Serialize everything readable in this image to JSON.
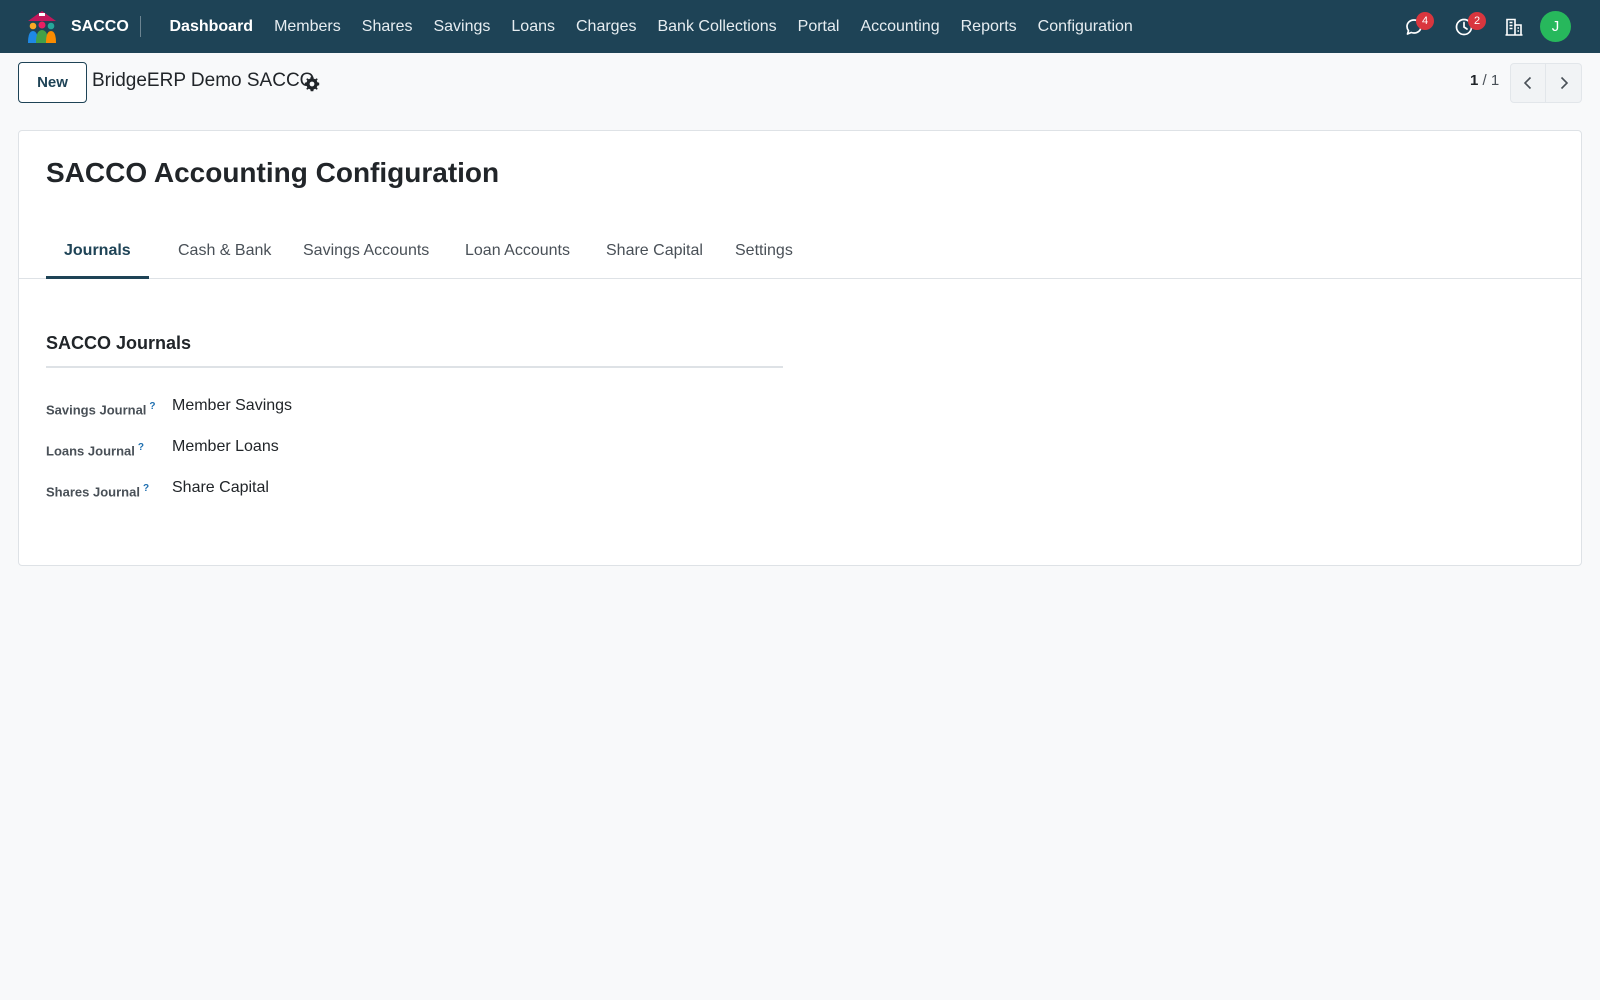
{
  "app": {
    "name": "SACCO",
    "menu": [
      {
        "label": "Dashboard",
        "active": true
      },
      {
        "label": "Members"
      },
      {
        "label": "Shares"
      },
      {
        "label": "Savings"
      },
      {
        "label": "Loans"
      },
      {
        "label": "Charges"
      },
      {
        "label": "Bank Collections"
      },
      {
        "label": "Portal"
      },
      {
        "label": "Accounting"
      },
      {
        "label": "Reports"
      },
      {
        "label": "Configuration"
      }
    ],
    "systray": {
      "messages_count": "4",
      "activities_count": "2",
      "user_initial": "J",
      "icons": [
        "chat-icon",
        "clock-icon",
        "building-icon"
      ]
    }
  },
  "control_panel": {
    "new_label": "New",
    "record_title": "BridgeERP Demo SACCO",
    "pager_current": "1",
    "pager_total": "/ 1"
  },
  "form": {
    "title": "SACCO Accounting Configuration",
    "tabs": [
      "Journals",
      "Cash & Bank",
      "Savings Accounts",
      "Loan Accounts",
      "Share Capital",
      "Settings"
    ],
    "active_tab": "Journals",
    "group_title": "SACCO Journals",
    "fields": [
      {
        "label": "Savings Journal",
        "help": "?",
        "value": "Member Savings"
      },
      {
        "label": "Loans Journal",
        "help": "?",
        "value": "Member Loans"
      },
      {
        "label": "Shares Journal",
        "help": "?",
        "value": "Share Capital"
      }
    ]
  },
  "colors": {
    "navbar": "#1e4356",
    "primary": "#1e4356",
    "badge": "#d9363e",
    "avatar": "#27b85c"
  }
}
